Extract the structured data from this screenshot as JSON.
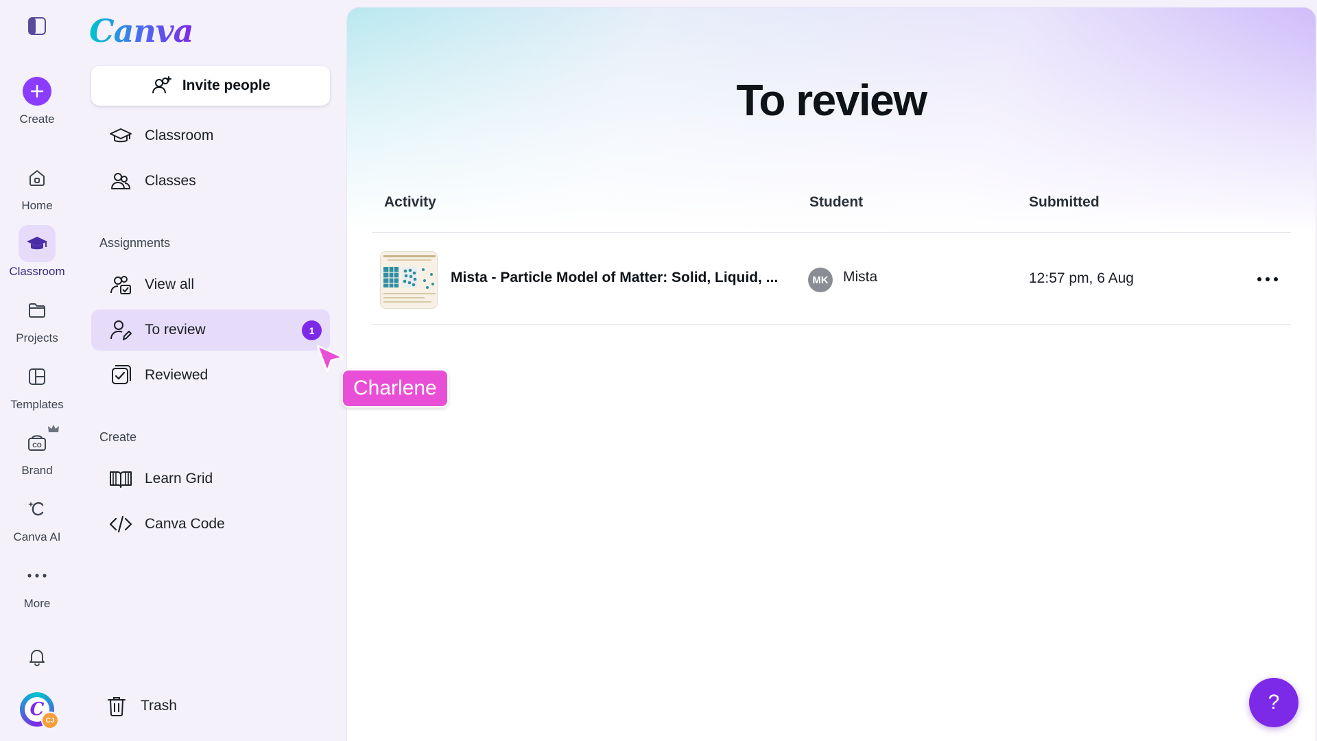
{
  "app": {
    "logo_text": "Canva"
  },
  "rail": {
    "items": [
      {
        "label": "Create",
        "icon": "plus-icon"
      },
      {
        "label": "Home",
        "icon": "home-icon"
      },
      {
        "label": "Classroom",
        "icon": "graduation-cap-icon",
        "active": true
      },
      {
        "label": "Projects",
        "icon": "folder-icon"
      },
      {
        "label": "Templates",
        "icon": "templates-icon"
      },
      {
        "label": "Brand",
        "icon": "brand-icon"
      },
      {
        "label": "Canva AI",
        "icon": "canva-ai-icon"
      },
      {
        "label": "More",
        "icon": "more-icon"
      }
    ],
    "avatar_initials": "CJ"
  },
  "panel": {
    "invite_label": "Invite people",
    "top_items": [
      {
        "label": "Classroom",
        "icon": "graduation-cap-icon"
      },
      {
        "label": "Classes",
        "icon": "people-icon"
      }
    ],
    "assignments_heading": "Assignments",
    "assignment_items": [
      {
        "label": "View all",
        "icon": "view-all-icon"
      },
      {
        "label": "To review",
        "icon": "user-edit-icon",
        "active": true,
        "badge": "1"
      },
      {
        "label": "Reviewed",
        "icon": "checkbox-icon"
      }
    ],
    "create_heading": "Create",
    "create_items": [
      {
        "label": "Learn Grid",
        "icon": "book-icon"
      },
      {
        "label": "Canva Code",
        "icon": "code-icon"
      }
    ],
    "trash_label": "Trash"
  },
  "main": {
    "title": "To review",
    "columns": {
      "activity": "Activity",
      "student": "Student",
      "submitted": "Submitted"
    },
    "rows": [
      {
        "activity": "Mista - Particle Model of Matter: Solid, Liquid, ...",
        "student_initials": "MK",
        "student_name": "Mista",
        "submitted": "12:57 pm, 6 Aug"
      }
    ]
  },
  "cursor": {
    "name": "Charlene"
  },
  "help": {
    "label": "?"
  },
  "colors": {
    "accent": "#8b3dff",
    "active_bg": "#e6dcf9",
    "badge": "#7d2ae8",
    "cursor_tag": "#e94fd6"
  }
}
